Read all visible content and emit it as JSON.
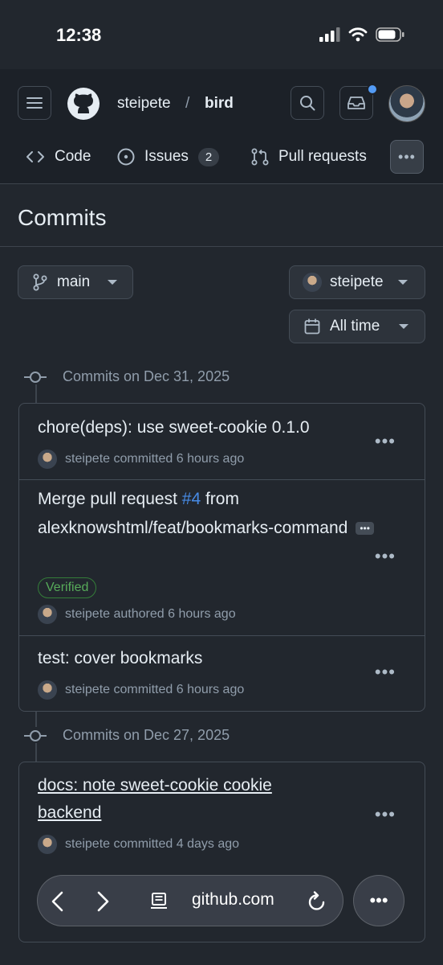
{
  "status": {
    "time": "12:38"
  },
  "header": {
    "owner": "steipete",
    "separator": "/",
    "repo": "bird"
  },
  "tabs": [
    {
      "label": "Code"
    },
    {
      "label": "Issues",
      "count": "2"
    },
    {
      "label": "Pull requests"
    }
  ],
  "page": {
    "title": "Commits"
  },
  "filters": {
    "branch": "main",
    "author": "steipete",
    "time": "All time"
  },
  "groups": [
    {
      "label": "Commits on Dec 31, 2025",
      "commits": [
        {
          "title": "chore(deps): use sweet-cookie 0.1.0",
          "meta": "steipete committed 6 hours ago"
        },
        {
          "title_pre": "Merge pull request ",
          "title_link": "#4",
          "title_post": " from alexknowshtml/feat/bookmarks-command",
          "badge": "Verified",
          "meta": "steipete authored 6 hours ago"
        },
        {
          "title": "test: cover bookmarks",
          "meta": "steipete committed 6 hours ago"
        }
      ]
    },
    {
      "label": "Commits on Dec 27, 2025",
      "commits": [
        {
          "title": "docs: note sweet-cookie cookie backend",
          "meta": "steipete committed 4 days ago"
        }
      ]
    }
  ],
  "browser": {
    "url": "github.com"
  },
  "colors": {
    "background": "#22272e",
    "link": "#478be6",
    "verified": "#57ab5a",
    "notification": "#539bf5"
  }
}
